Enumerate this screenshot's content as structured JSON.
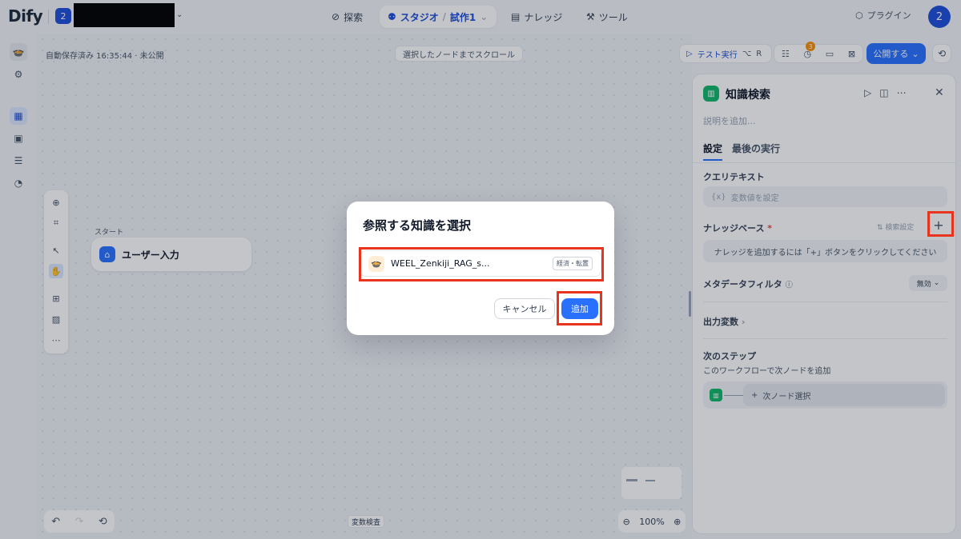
{
  "header": {
    "logo": "Dify",
    "workspace_badge": "2",
    "nav": {
      "explore": "探索",
      "studio": "スタジオ",
      "app_name": "試作1",
      "knowledge": "ナレッジ",
      "tools": "ツール"
    },
    "plugins": "プラグイン",
    "avatar": "2"
  },
  "canvas": {
    "autosave": "自動保存済み 16:35:44 · 未公開",
    "scroll_to_node": "選択したノードまでスクロール",
    "start_label": "スタート",
    "start_node": "ユーザー入力",
    "variable_inspect": "変数検査",
    "zoom_level": "100%"
  },
  "actions": {
    "test_run": "テスト実行",
    "shortcut_alt": "⌥",
    "shortcut_key": "R",
    "notif_count": "3",
    "publish": "公開する"
  },
  "panel": {
    "title": "知識検索",
    "description_placeholder": "説明を追加...",
    "tabs": {
      "settings": "設定",
      "last_run": "最後の実行"
    },
    "query_label": "クエリテキスト",
    "query_prefix": "{x}",
    "query_placeholder": "変数値を設定",
    "kb_label": "ナレッジベース",
    "kb_required": "*",
    "search_settings": "検索設定",
    "add_symbol": "+",
    "kb_empty": "ナレッジを追加するには「+」ボタンをクリックしてください",
    "metadata_label": "メタデータフィルタ",
    "metadata_value": "無効",
    "output_label": "出力変数",
    "next_step_label": "次のステップ",
    "next_step_desc": "このワークフローで次ノードを追加",
    "next_node_select": "次ノード選択"
  },
  "dialog": {
    "title": "参照する知識を選択",
    "kb_item_name": "WEEL_Zenkiji_RAG_s...",
    "kb_item_tag": "経済・転置",
    "cancel": "キャンセル",
    "add": "追加"
  }
}
